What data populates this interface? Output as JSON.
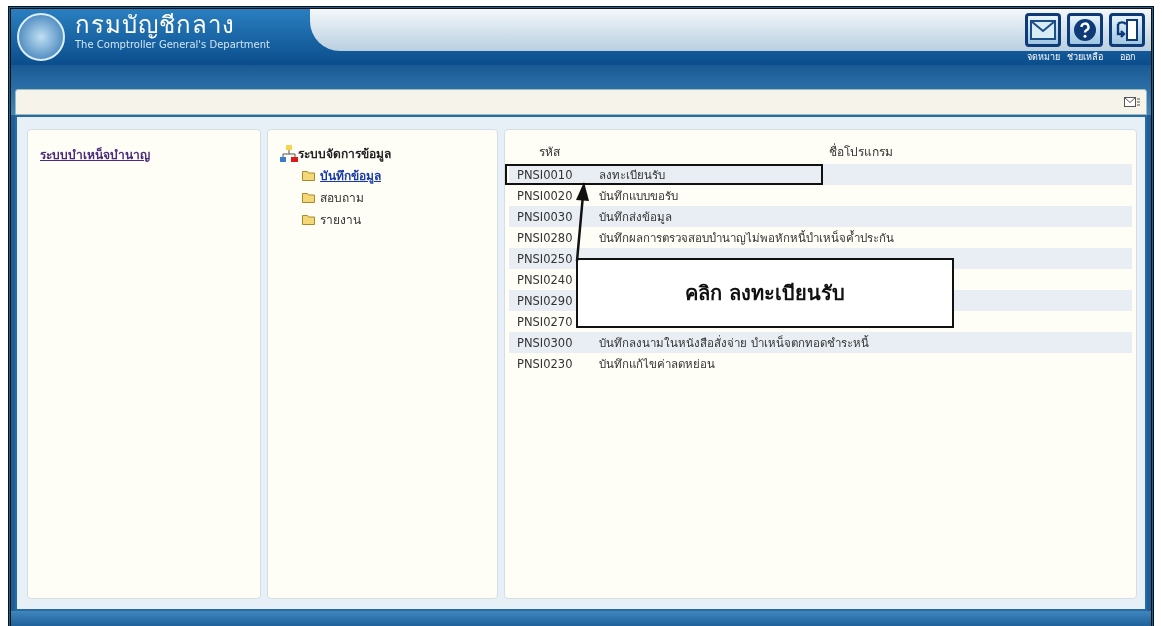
{
  "header": {
    "title": "กรมบัญชีกลาง",
    "subtitle": "The Comptroller General's Department",
    "actions": [
      {
        "kind": "mail",
        "label": "จดหมาย"
      },
      {
        "kind": "help",
        "label": "ช่วยเหลือ"
      },
      {
        "kind": "exit",
        "label": "ออก"
      }
    ]
  },
  "left_panel": {
    "link": "ระบบบำเหน็จบำนาญ"
  },
  "tree": {
    "root": "ระบบจัดการข้อมูล",
    "children": [
      {
        "label": "บันทึกข้อมูล",
        "selected": true
      },
      {
        "label": "สอบถาม",
        "selected": false
      },
      {
        "label": "รายงาน",
        "selected": false
      }
    ]
  },
  "table": {
    "columns": [
      "รหัส",
      "ชื่อโปรแกรม"
    ],
    "rows": [
      {
        "code": "PNSI0010",
        "name": "ลงทะเบียนรับ",
        "highlighted": true
      },
      {
        "code": "PNSI0020",
        "name": "บันทึกแบบขอรับ",
        "highlighted": false
      },
      {
        "code": "PNSI0030",
        "name": "บันทึกส่งข้อมูล",
        "highlighted": false
      },
      {
        "code": "PNSI0280",
        "name": "บันทึกผลการตรวจสอบบำนาญไม่พอหักหนี้บำเหน็จค้ำประกัน",
        "highlighted": false
      },
      {
        "code": "PNSI0250",
        "highlighted": false
      },
      {
        "code": "PNSI0240",
        "highlighted": false
      },
      {
        "code": "PNSI0290",
        "highlighted": false
      },
      {
        "code": "PNSI0270",
        "highlighted": false
      },
      {
        "code": "PNSI0300",
        "name": "บันทึกลงนามในหนังสือสั่งจ่าย บำเหน็จตกทอดชำระหนี้",
        "highlighted": false
      },
      {
        "code": "PNSI0230",
        "name": "บันทึกแก้ไขค่าลดหย่อน",
        "highlighted": false
      }
    ]
  },
  "callout": {
    "text": "คลิก ลงทะเบียนรับ"
  }
}
